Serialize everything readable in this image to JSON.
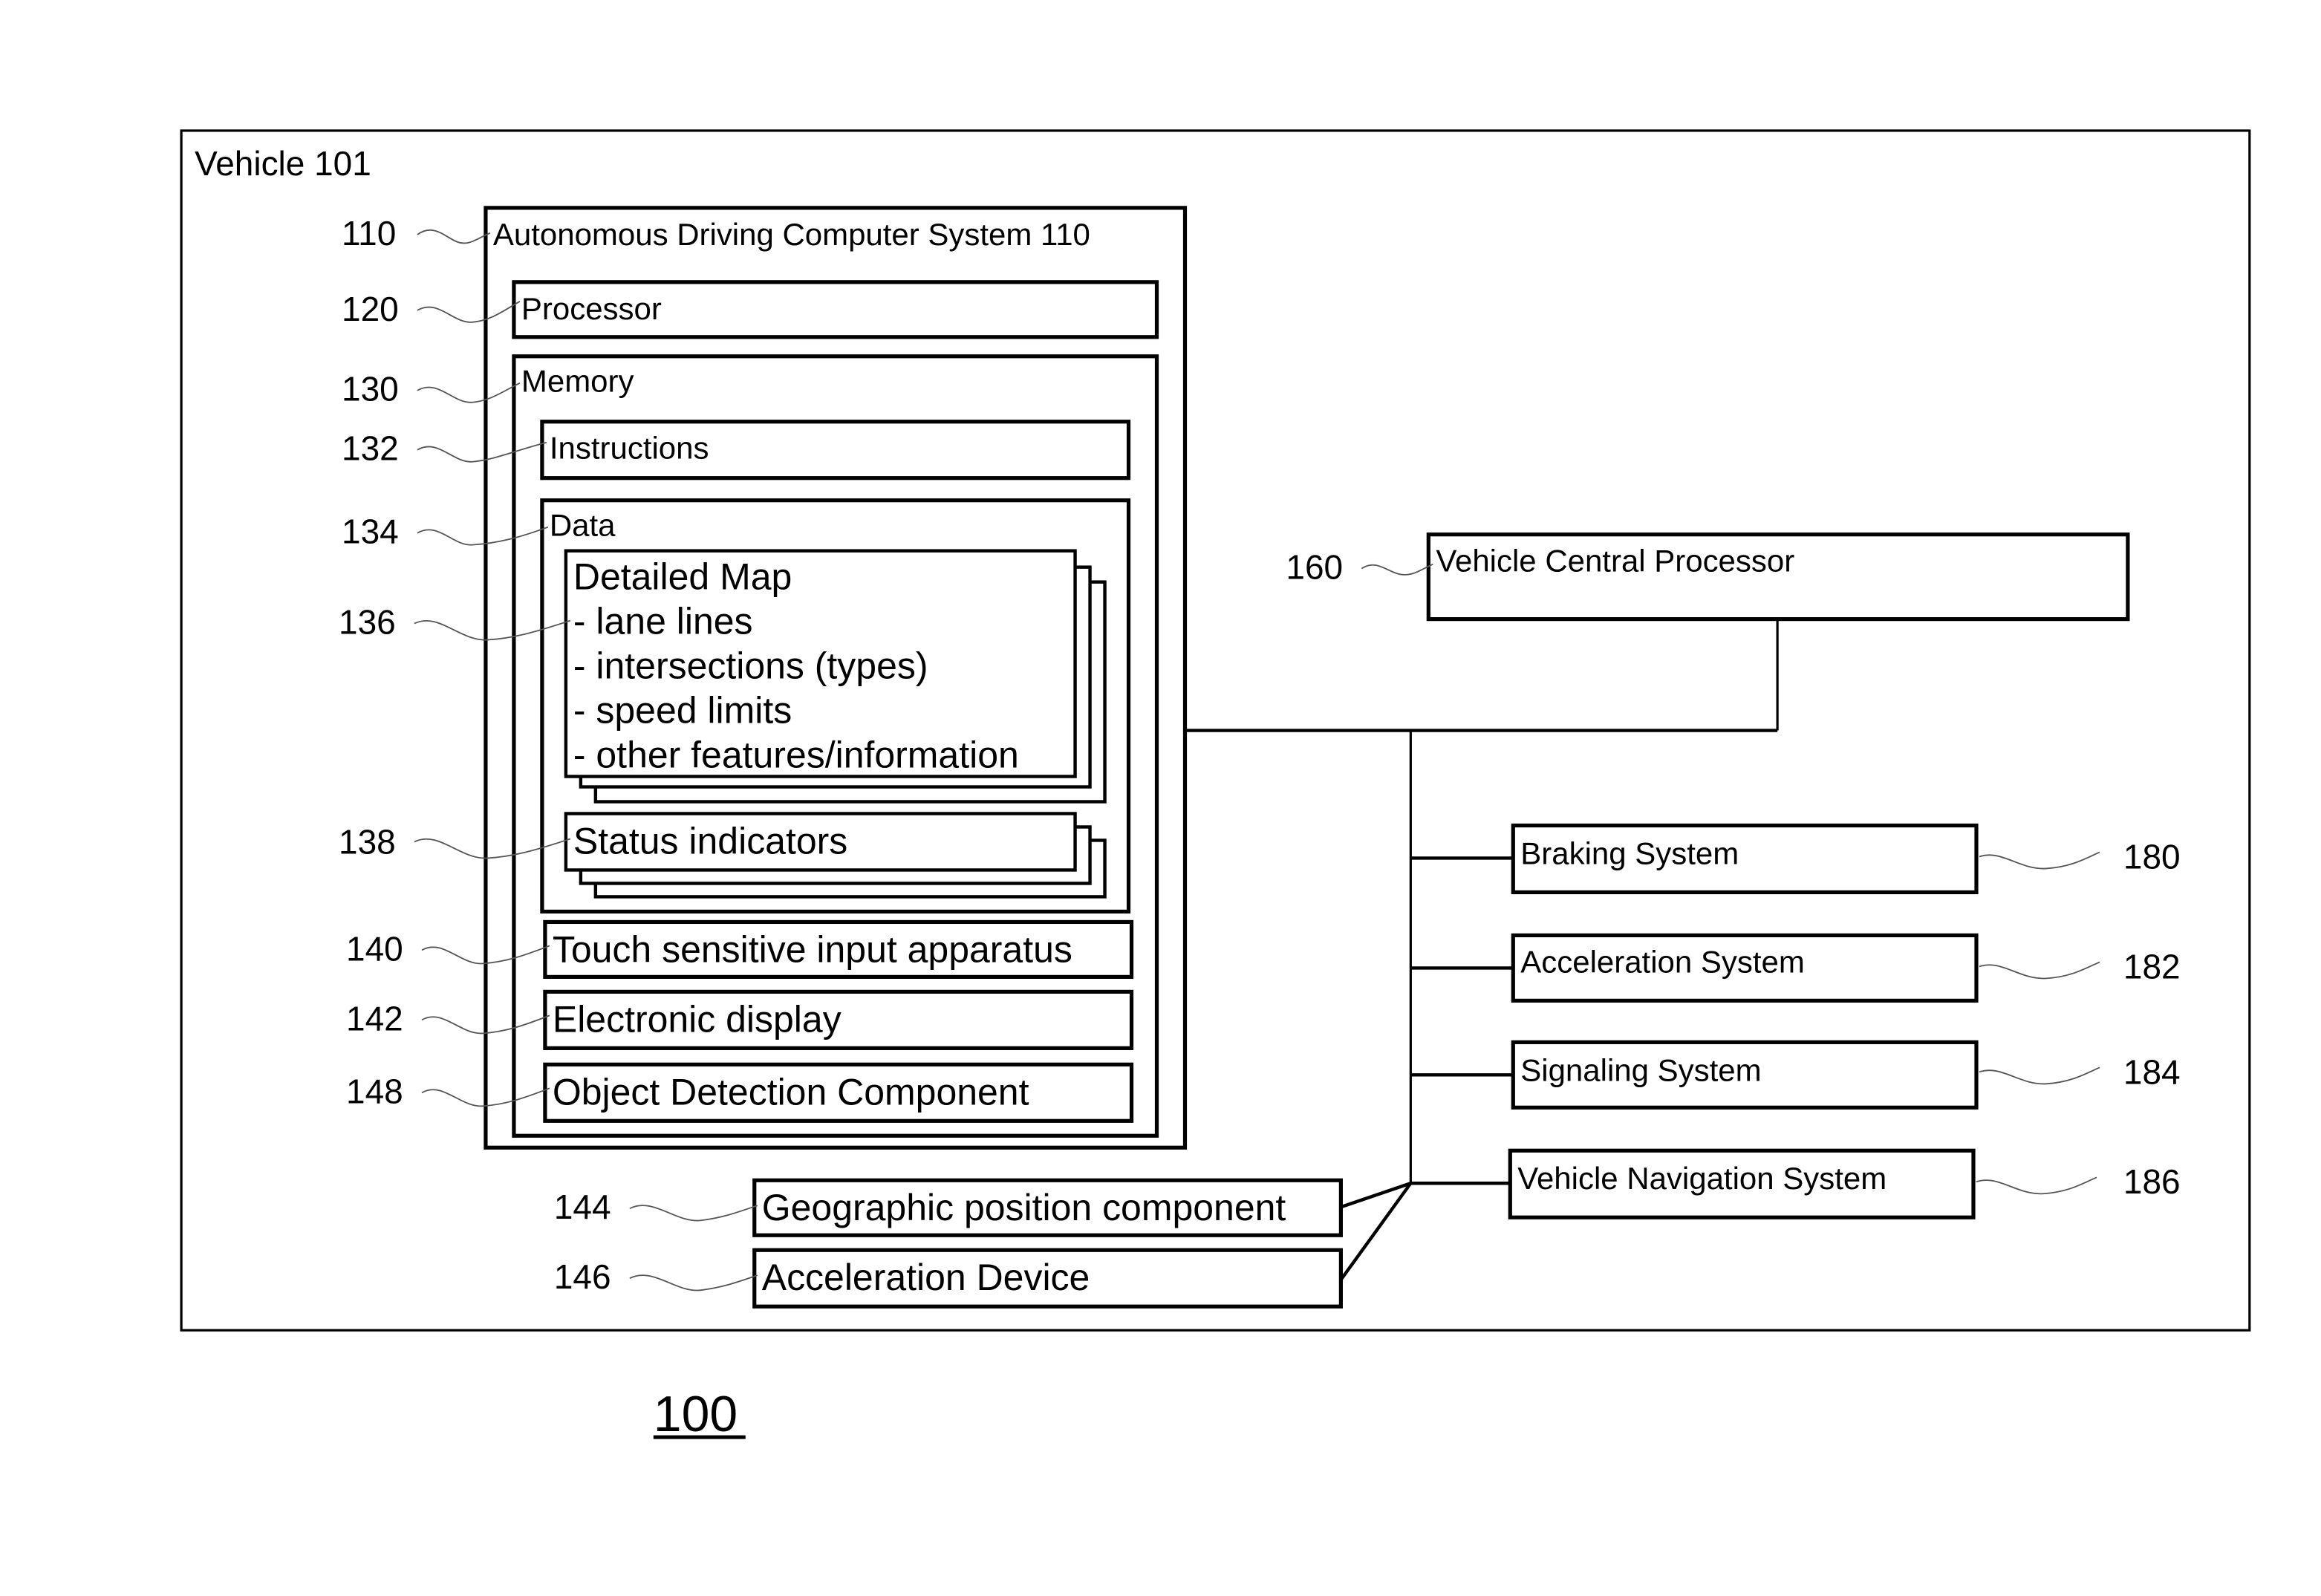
{
  "diagram": {
    "figure_number": "100",
    "vehicle": {
      "label": "Vehicle 101"
    },
    "adcs": {
      "ref": "110",
      "label": "Autonomous Driving Computer System 110"
    },
    "processor": {
      "ref": "120",
      "label": "Processor"
    },
    "memory": {
      "ref": "130",
      "label": "Memory"
    },
    "instructions": {
      "ref": "132",
      "label": "Instructions"
    },
    "data": {
      "ref": "134",
      "label": "Data"
    },
    "detailed_map": {
      "ref": "136",
      "title": "Detailed Map",
      "items": [
        "- lane lines",
        "- intersections (types)",
        "- speed limits",
        "- other features/information"
      ]
    },
    "status_indicators": {
      "ref": "138",
      "label": "Status indicators"
    },
    "touch_input": {
      "ref": "140",
      "label": "Touch sensitive input apparatus"
    },
    "electronic_display": {
      "ref": "142",
      "label": "Electronic display"
    },
    "object_detection": {
      "ref": "148",
      "label": "Object Detection Component"
    },
    "geographic_position": {
      "ref": "144",
      "label": "Geographic position component"
    },
    "acceleration_device": {
      "ref": "146",
      "label": "Acceleration Device"
    },
    "vehicle_central_processor": {
      "ref": "160",
      "label": "Vehicle Central Processor"
    },
    "braking_system": {
      "ref": "180",
      "label": "Braking System"
    },
    "acceleration_system": {
      "ref": "182",
      "label": "Acceleration System"
    },
    "signaling_system": {
      "ref": "184",
      "label": "Signaling System"
    },
    "navigation_system": {
      "ref": "186",
      "label": "Vehicle Navigation System"
    }
  }
}
